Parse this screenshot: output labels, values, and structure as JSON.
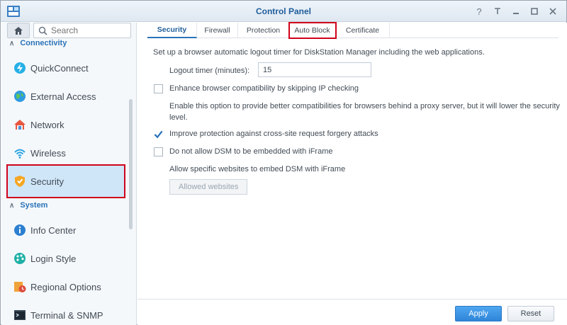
{
  "window": {
    "title": "Control Panel",
    "buttons": [
      "help-icon",
      "pin-icon",
      "minimize-icon",
      "maximize-icon",
      "close-icon"
    ]
  },
  "sidebar": {
    "search_placeholder": "Search",
    "groups": [
      {
        "label": "Connectivity",
        "items": [
          {
            "label": "QuickConnect",
            "icon": "quickconnect-icon"
          },
          {
            "label": "External Access",
            "icon": "globe-icon"
          },
          {
            "label": "Network",
            "icon": "house-icon"
          },
          {
            "label": "Wireless",
            "icon": "wifi-icon"
          },
          {
            "label": "Security",
            "icon": "shield-icon",
            "active": true
          }
        ]
      },
      {
        "label": "System",
        "items": [
          {
            "label": "Info Center",
            "icon": "info-icon"
          },
          {
            "label": "Login Style",
            "icon": "palette-icon"
          },
          {
            "label": "Regional Options",
            "icon": "clock-calendar-icon"
          },
          {
            "label": "Terminal & SNMP",
            "icon": "terminal-icon"
          }
        ]
      }
    ]
  },
  "tabs": [
    {
      "label": "Security",
      "active": true
    },
    {
      "label": "Firewall"
    },
    {
      "label": "Protection"
    },
    {
      "label": "Auto Block",
      "highlighted": true
    },
    {
      "label": "Certificate"
    }
  ],
  "content": {
    "intro": "Set up a browser automatic logout timer for DiskStation Manager including the web applications.",
    "logout_label": "Logout timer (minutes):",
    "logout_value": "15",
    "opt_compat_label": "Enhance browser compatibility by skipping IP checking",
    "opt_compat_checked": false,
    "opt_compat_desc": "Enable this option to provide better compatibilities for browsers behind a proxy server, but it will lower the security level.",
    "opt_csrf_label": "Improve protection against cross-site request forgery attacks",
    "opt_csrf_checked": true,
    "opt_iframe_label": "Do not allow DSM to be embedded with iFrame",
    "opt_iframe_checked": false,
    "iframe_allow_text": "Allow specific websites to embed DSM with iFrame",
    "allowed_websites_label": "Allowed websites"
  },
  "footer": {
    "apply_label": "Apply",
    "reset_label": "Reset"
  },
  "colors": {
    "accent": "#2a73b8",
    "highlight_border": "#d0021b",
    "active_bg": "#cfe6f8"
  }
}
